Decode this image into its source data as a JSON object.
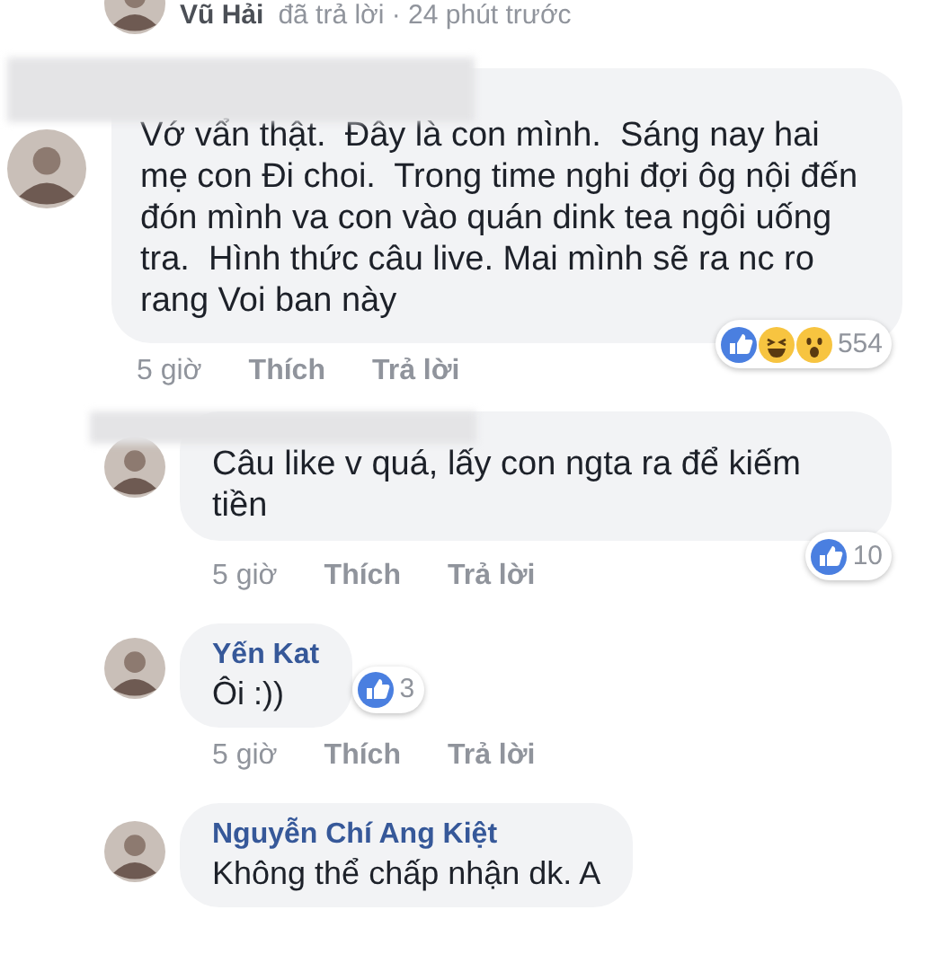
{
  "reply_notice": {
    "name": "Vũ Hải",
    "text": "đã trả lời · 24 phút trước"
  },
  "comments": [
    {
      "name_redacted": true,
      "text": "Vớ vẩn thật.  Đây là con mình.  Sáng nay hai mẹ con Đi choi.  Trong time nghi đợi ôg nội đến đón mình va con vào quán dink tea ngôi uống tra.  Hình thức câu live. Mai mình sẽ ra nc ro rang Voi ban này",
      "time": "5 giờ",
      "like": "Thích",
      "reply": "Trả lời",
      "reactions": {
        "icons": [
          {
            "kind": "like"
          },
          {
            "kind": "haha"
          },
          {
            "kind": "wow"
          }
        ],
        "count": "554"
      }
    },
    {
      "name_redacted": true,
      "text": "Câu like v quá, lấy con ngta ra để kiếm tiền",
      "time": "5 giờ",
      "like": "Thích",
      "reply": "Trả lời",
      "reactions": {
        "icons": [
          {
            "kind": "like"
          }
        ],
        "count": "10"
      }
    },
    {
      "name_redacted": false,
      "name": "Yến Kat",
      "text": "Ôi :))",
      "time": "5 giờ",
      "like": "Thích",
      "reply": "Trả lời",
      "reactions": {
        "icons": [
          {
            "kind": "like"
          }
        ],
        "count": "3"
      }
    },
    {
      "name_redacted": false,
      "name": "Nguyễn Chí Ang Kiệt",
      "text": "Không thể chấp nhận dk. A"
    }
  ]
}
